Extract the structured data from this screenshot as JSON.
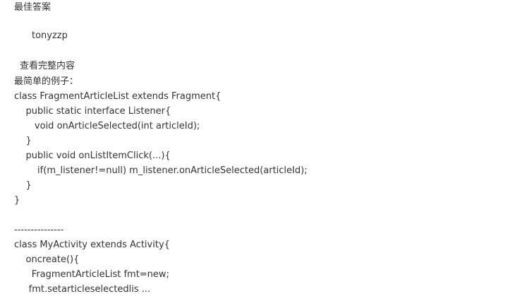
{
  "answer": {
    "section_title": "最佳答案",
    "author": "tonyzzp",
    "view_full_label": "查看完整内容",
    "lines": [
      "最简单的例子：",
      "class FragmentArticleList extends Fragment{",
      "    public static interface Listener{",
      "       void onArticleSelected(int articleId);",
      "    }",
      "    public void onListItemClick(...){",
      "        if(m_listener!=null) m_listener.onArticleSelected(articleId);",
      "    }",
      "}",
      "",
      "---------------",
      "class MyActivity extends Activity{",
      "    oncreate(){",
      "      FragmentArticleList fmt=new;",
      "     fmt.setarticleselectedlis ..."
    ]
  }
}
